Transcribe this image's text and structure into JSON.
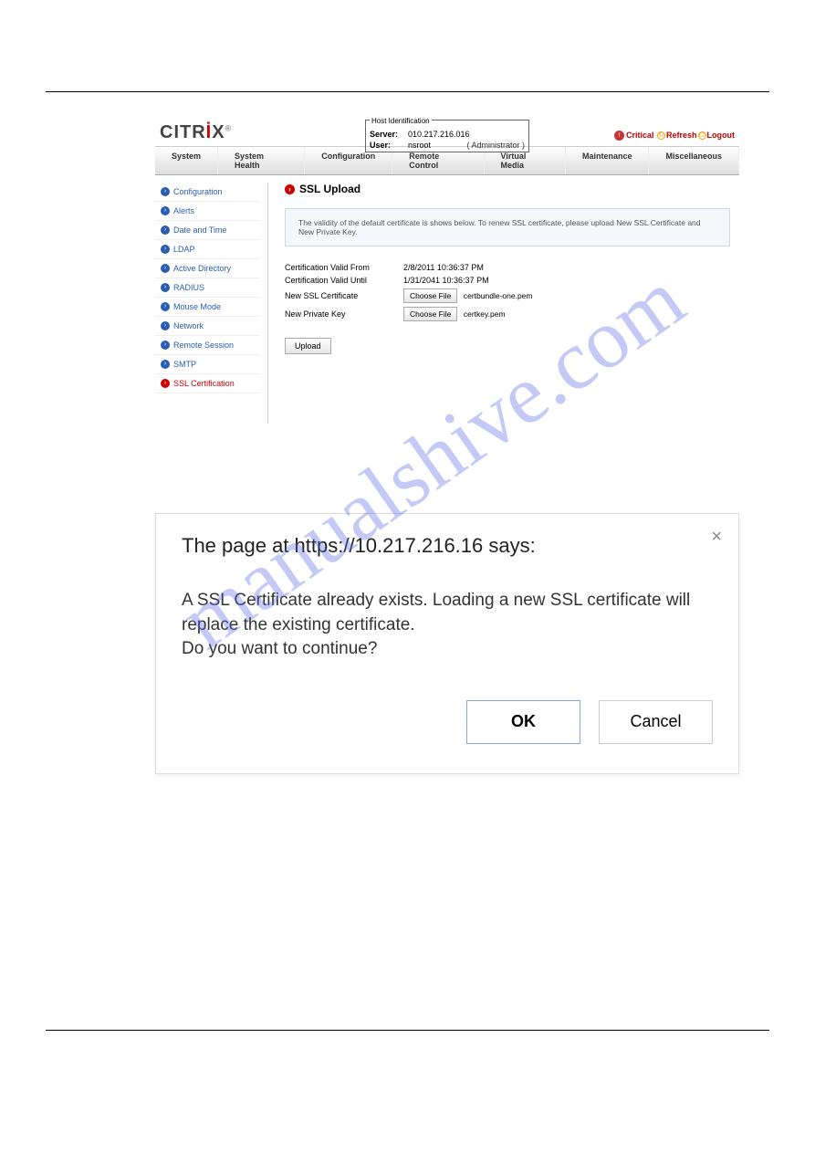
{
  "logo": {
    "text_pre": "CITR",
    "dot": "İ",
    "text_post": "X",
    "reg": "®"
  },
  "hostid": {
    "legend": "Host Identification",
    "server_label": "Server:",
    "server_value": "010.217.216.016",
    "user_label": "User:",
    "user_value": "nsroot",
    "user_role": "( Administrator )"
  },
  "toplinks": {
    "critical": "Critical",
    "refresh": "Refresh",
    "logout": "Logout"
  },
  "menubar": [
    "System",
    "System Health",
    "Configuration",
    "Remote Control",
    "Virtual Media",
    "Maintenance",
    "Miscellaneous"
  ],
  "sidebar": {
    "items": [
      {
        "label": "Configuration"
      },
      {
        "label": "Alerts"
      },
      {
        "label": "Date and Time"
      },
      {
        "label": "LDAP"
      },
      {
        "label": "Active Directory"
      },
      {
        "label": "RADIUS"
      },
      {
        "label": "Mouse Mode"
      },
      {
        "label": "Network"
      },
      {
        "label": "Remote Session"
      },
      {
        "label": "SMTP"
      },
      {
        "label": "SSL Certification"
      }
    ]
  },
  "main": {
    "title": "SSL Upload",
    "info": "The validity of the default certificate is shows below. To renew SSL certificate, please upload New SSL Certificate and New Private Key.",
    "rows": {
      "valid_from_label": "Certification Valid From",
      "valid_from_value": "2/8/2011 10:36:37 PM",
      "valid_until_label": "Certification Valid Until",
      "valid_until_value": "1/31/2041 10:36:37 PM",
      "new_cert_label": "New SSL Certificate",
      "new_key_label": "New Private Key"
    },
    "choose_file": "Choose File",
    "cert_filename": "certbundle-one.pem",
    "key_filename": "certkey.pem",
    "upload": "Upload"
  },
  "dialog": {
    "title": "The page at https://10.217.216.16 says:",
    "body_line1": "A SSL Certificate already exists. Loading a new SSL certificate will replace the existing certificate.",
    "body_line2": "Do you want to continue?",
    "ok": "OK",
    "cancel": "Cancel"
  },
  "watermark": "manualshive.com"
}
